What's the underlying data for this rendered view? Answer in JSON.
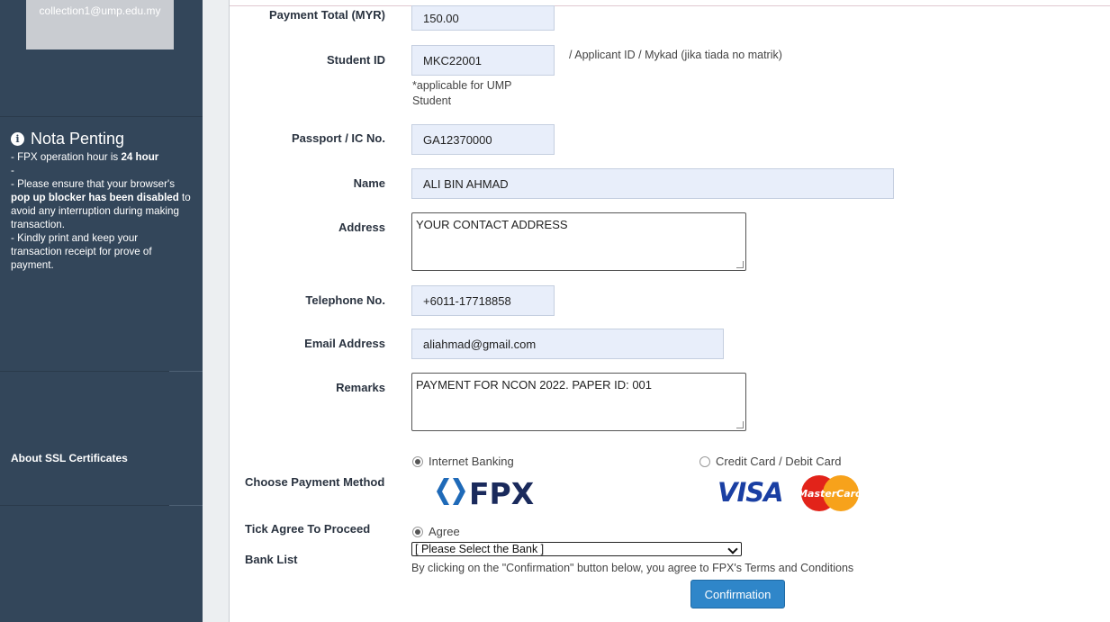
{
  "sidebar": {
    "email": "collection1@ump.edu.my",
    "nota_title": "Nota Penting",
    "about_ssl": "About SSL Certificates"
  },
  "form": {
    "payment_total_label": "Payment Total (MYR)",
    "payment_total_value": "150.00",
    "student_id_label": "Student ID",
    "student_id_value": "MKC22001",
    "student_id_hint": "/ Applicant ID / Mykad (jika tiada no matrik)",
    "student_id_note": "*applicable for UMP Student",
    "passport_label": "Passport / IC No.",
    "passport_value": "GA12370000",
    "name_label": "Name",
    "name_value": "ALI BIN AHMAD",
    "address_label": "Address",
    "address_value": "YOUR CONTACT ADDRESS",
    "telephone_label": "Telephone No.",
    "telephone_value": "+6011-17718858",
    "email_label": "Email Address",
    "email_value": "aliahmad@gmail.com",
    "remarks_label": "Remarks",
    "remarks_value": "PAYMENT FOR NCON 2022. PAPER ID: 001"
  },
  "payment": {
    "method_label": "Choose Payment Method",
    "internet_banking": "Internet Banking",
    "credit_card": "Credit Card / Debit Card",
    "fpx_logo_text": "FPX",
    "visa_logo_text": "VISA",
    "mastercard_logo_text": "MasterCard",
    "agree_label": "Tick Agree To Proceed",
    "agree_option": "Agree",
    "bank_list_label": "Bank List",
    "bank_select_value": "[ Please Select the Bank ]",
    "terms_text": "By clicking on the \"Confirmation\" button below, you agree to FPX's Terms and Conditions",
    "confirm_button": "Confirmation"
  },
  "colors": {
    "sidebar_bg": "#33465a",
    "button_bg": "#2f86c9",
    "field_bg": "#e8eefa",
    "visa_blue": "#1a3fa3"
  }
}
